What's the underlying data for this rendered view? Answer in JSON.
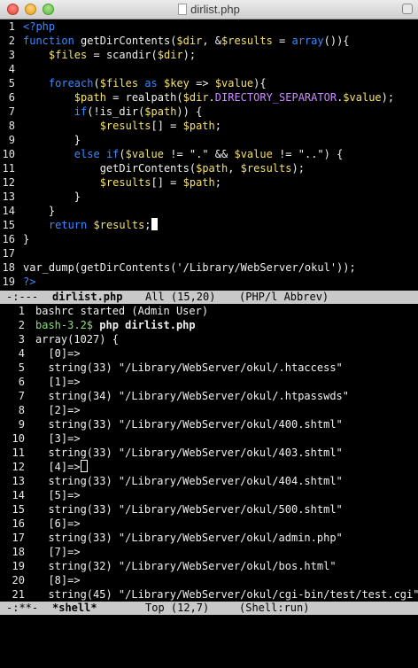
{
  "window": {
    "title": "dirlist.php"
  },
  "colors": {
    "background": "#000000",
    "keyword": "#3a8bff",
    "variable": "#f5e26b",
    "function": "#c78bff",
    "constant": "#c78bff",
    "string": "#f0f0f0",
    "shell_path_string": "#ffffff",
    "prompt": "#88e07a",
    "text": "#f0f0f0",
    "modeline_bg": "#c9c9c9"
  },
  "editor": {
    "lines": [
      {
        "n": "1",
        "t": "<?php"
      },
      {
        "n": "2",
        "t": "function getDirContents($dir, &$results = array()){"
      },
      {
        "n": "3",
        "t": "    $files = scandir($dir);"
      },
      {
        "n": "4",
        "t": ""
      },
      {
        "n": "5",
        "t": "    foreach($files as $key => $value){"
      },
      {
        "n": "6",
        "t": "        $path = realpath($dir.DIRECTORY_SEPARATOR.$value);"
      },
      {
        "n": "7",
        "t": "        if(!is_dir($path)) {"
      },
      {
        "n": "8",
        "t": "            $results[] = $path;"
      },
      {
        "n": "9",
        "t": "        }"
      },
      {
        "n": "10",
        "t": "        else if($value != \".\" && $value != \"..\") {"
      },
      {
        "n": "11",
        "t": "            getDirContents($path, $results);"
      },
      {
        "n": "12",
        "t": "            $results[] = $path;"
      },
      {
        "n": "13",
        "t": "        }"
      },
      {
        "n": "14",
        "t": "    }"
      },
      {
        "n": "15",
        "t": "    return $results;"
      },
      {
        "n": "16",
        "t": "}"
      },
      {
        "n": "17",
        "t": ""
      },
      {
        "n": "18",
        "t": "var_dump(getDirContents('/Library/WebServer/okul'));"
      },
      {
        "n": "19",
        "t": "?>"
      }
    ],
    "modeline": {
      "flags": "-:---",
      "buffer": "dirlist.php",
      "position": "All (15,20)",
      "mode": "(PHP/l Abbrev)"
    }
  },
  "shell": {
    "lines": [
      {
        "n": "1",
        "t": "bashrc started (Admin User)"
      },
      {
        "n": "2",
        "t": "bash-3.2$ php dirlist.php"
      },
      {
        "n": "3",
        "t": "array(1027) {"
      },
      {
        "n": "4",
        "t": "  [0]=>"
      },
      {
        "n": "5",
        "t": "  string(33) \"/Library/WebServer/okul/.htaccess\""
      },
      {
        "n": "6",
        "t": "  [1]=>"
      },
      {
        "n": "7",
        "t": "  string(34) \"/Library/WebServer/okul/.htpasswds\""
      },
      {
        "n": "8",
        "t": "  [2]=>"
      },
      {
        "n": "9",
        "t": "  string(33) \"/Library/WebServer/okul/400.shtml\""
      },
      {
        "n": "10",
        "t": "  [3]=>"
      },
      {
        "n": "11",
        "t": "  string(33) \"/Library/WebServer/okul/403.shtml\""
      },
      {
        "n": "12",
        "t": "  [4]=>"
      },
      {
        "n": "13",
        "t": "  string(33) \"/Library/WebServer/okul/404.shtml\""
      },
      {
        "n": "14",
        "t": "  [5]=>"
      },
      {
        "n": "15",
        "t": "  string(33) \"/Library/WebServer/okul/500.shtml\""
      },
      {
        "n": "16",
        "t": "  [6]=>"
      },
      {
        "n": "17",
        "t": "  string(33) \"/Library/WebServer/okul/admin.php\""
      },
      {
        "n": "18",
        "t": "  [7]=>"
      },
      {
        "n": "19",
        "t": "  string(32) \"/Library/WebServer/okul/bos.html\""
      },
      {
        "n": "20",
        "t": "  [8]=>"
      },
      {
        "n": "21",
        "t": "  string(45) \"/Library/WebServer/okul/cgi-bin/test/test.cgi\""
      }
    ],
    "modeline": {
      "flags": "-:**-",
      "buffer": "*shell*",
      "position": "Top (12,7)",
      "mode": "(Shell:run)"
    }
  }
}
